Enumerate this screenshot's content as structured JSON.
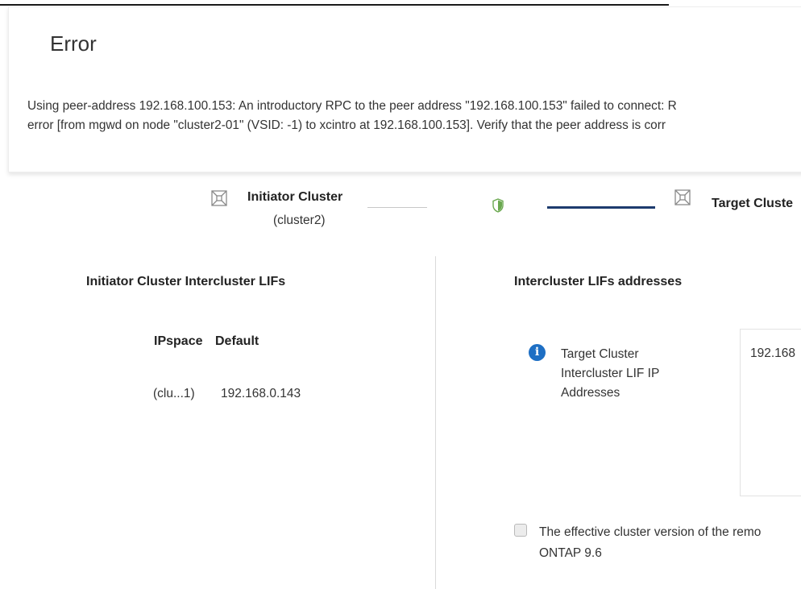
{
  "error": {
    "title": "Error",
    "message_line1": "Using peer-address 192.168.100.153: An introductory RPC to the peer address \"192.168.100.153\" failed to connect: R",
    "message_line2": "error [from mgwd on node \"cluster2-01\" (VSID: -1) to xcintro at 192.168.100.153]. Verify that the peer address is corr"
  },
  "topology": {
    "initiator_label": "Initiator Cluster",
    "initiator_name": "(cluster2)",
    "target_label": "Target Cluste",
    "icons": {
      "cluster": "cluster-node-icon",
      "shield": "shield-icon"
    },
    "colors": {
      "link_active": "#1d3b6e",
      "shield": "#6aa84f"
    }
  },
  "left_panel": {
    "heading": "Initiator Cluster Intercluster LIFs",
    "ipspace_label": "IPspace",
    "ipspace_value": "Default",
    "lif_node": "(clu...1)",
    "lif_ip": "192.168.0.143"
  },
  "right_panel": {
    "heading": "Intercluster LIFs addresses",
    "field_label_line1": "Target Cluster",
    "field_label_line2": "Intercluster LIF IP",
    "field_label_line3": "Addresses",
    "field_value": "192.168",
    "info_icon": "info-icon",
    "checkbox_line1": "The effective cluster version of the remo",
    "checkbox_line2": "ONTAP 9.6",
    "checkbox_checked": false
  }
}
